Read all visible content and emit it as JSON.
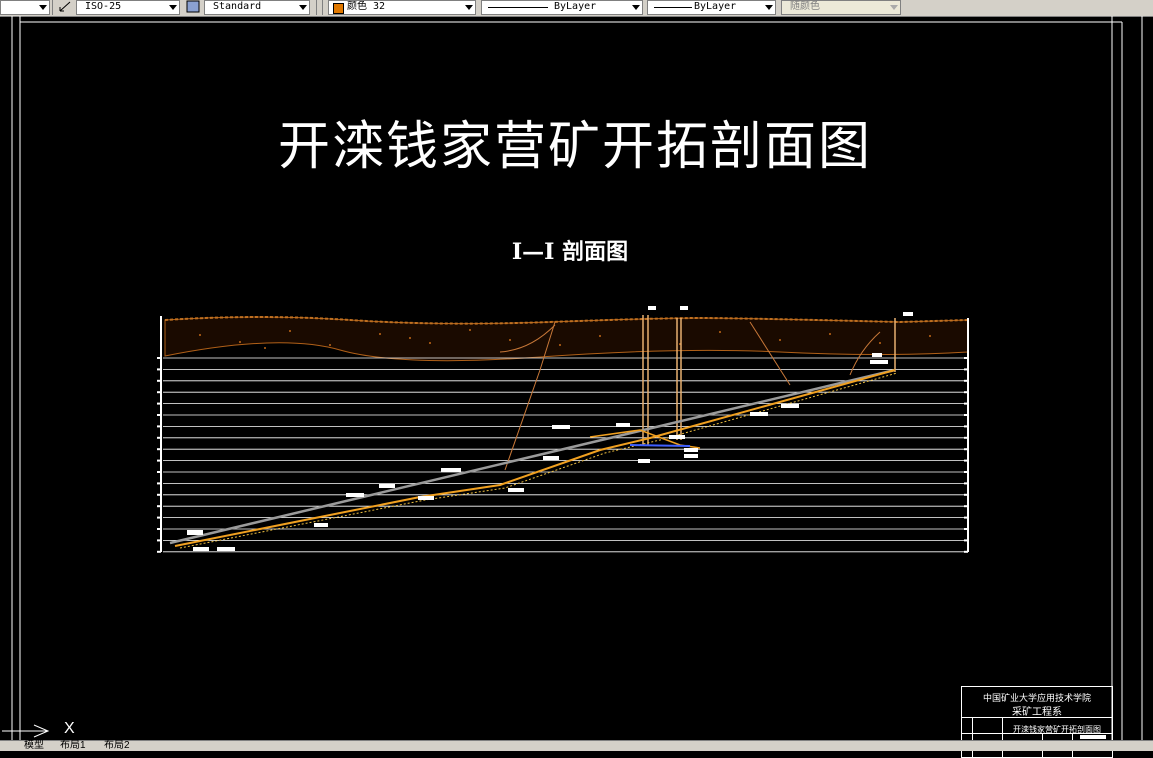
{
  "toolbar": {
    "dimstyle": "ISO-25",
    "textstyle": "Standard",
    "color": "颜色 32",
    "color_swatch": "#e07800",
    "linetype": "ByLayer",
    "lineweight": "ByLayer",
    "plotstyle": "随颜色"
  },
  "drawing": {
    "title": "开滦钱家营矿开拓剖面图",
    "subtitle": "I—I 剖面图"
  },
  "title_block": {
    "school": "中国矿业大学应用技术学院",
    "department": "采矿工程系",
    "drawing_name": "开滦钱家营矿开拓剖面图"
  },
  "ucs_label": "X",
  "tabs": [
    {
      "label": "模型"
    },
    {
      "label": "布局1"
    },
    {
      "label": "布局2"
    }
  ],
  "colors": {
    "background": "#000000",
    "seam": "#f0a020",
    "soil": "#b06018",
    "line": "#ffffff"
  }
}
